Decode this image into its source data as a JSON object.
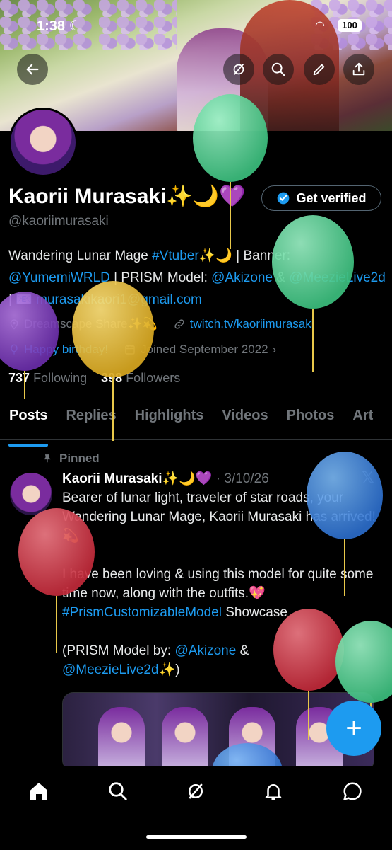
{
  "status_bar": {
    "time": "1:38",
    "battery": "100"
  },
  "profile": {
    "name": "Kaorii Murasaki✨🌙💜",
    "handle": "@kaoriimurasaki",
    "verify_label": "Get verified",
    "bio_part1": "Wandering Lunar Mage ",
    "bio_tag": "#Vtuber",
    "bio_part2": "✨🌙 | Banner: ",
    "bio_mention1": "@YumemiWRLD",
    "bio_part3": " | PRISM Model: ",
    "bio_mention2": "@Akizone",
    "bio_part4": " & ",
    "bio_mention3": "@MeezieLive2d",
    "bio_part5": " | 📧 ",
    "bio_email": "murasakikaori1@gmail.com",
    "location": "Dreamscape Share✨💫",
    "website": "twitch.tv/kaoriimurasaki",
    "birthday": "Happy birthday!",
    "joined": "Joined September 2022",
    "following_count": "737",
    "following_label": "Following",
    "followers_count": "398",
    "followers_label": "Followers"
  },
  "tabs": [
    "Posts",
    "Replies",
    "Highlights",
    "Videos",
    "Photos",
    "Art"
  ],
  "post": {
    "pinned_label": "Pinned",
    "author": "Kaorii Murasaki✨🌙💜",
    "date": "· 3/10/26",
    "line1": "Bearer of lunar light, traveler of star roads, your Wandering Lunar Mage, Kaorii Murasaki has arrived!💫",
    "line2": "I have been loving & using this model for quite some time now, along with the outfits.💖",
    "hashtag": "#PrismCustomizableModel",
    "showcase": " Showcase",
    "credit_open": "(PRISM Model by: ",
    "credit_mention1": "@Akizone",
    "credit_amp": " &",
    "credit_mention2": "@MeezieLive2d",
    "credit_close": "✨)"
  },
  "fab_label": "+",
  "icons": {
    "back": "arrow-left-icon",
    "grok": "grok-icon",
    "search": "search-icon",
    "edit": "pencil-icon",
    "share": "share-icon",
    "verified": "verified-badge-icon",
    "location": "location-pin-icon",
    "link": "link-icon",
    "balloon": "balloon-icon",
    "calendar": "calendar-icon",
    "pin": "pin-icon",
    "x_logo": "x-logo-icon",
    "home": "home-icon",
    "bell": "bell-icon",
    "messages": "chat-bubble-icon"
  },
  "colors": {
    "accent": "#1d9bf0",
    "muted": "#71767b",
    "background": "#000000"
  }
}
